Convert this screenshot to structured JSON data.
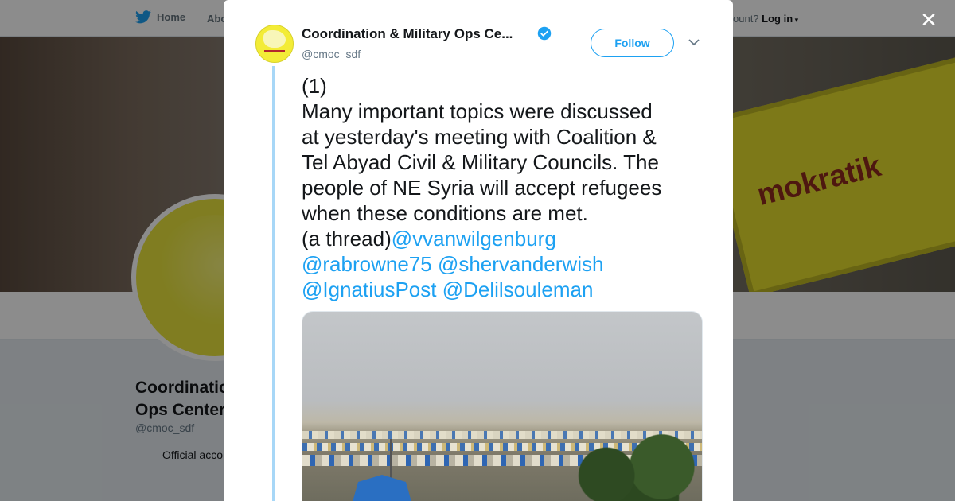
{
  "background": {
    "nav": {
      "home_label": "Home",
      "about_label": "Abo",
      "account_prompt": "ccount?",
      "login_label": "Log in"
    },
    "banner_patch_text": "mokratik",
    "profile": {
      "name": "Coordinatio Ops Center",
      "handle": "@cmoc_sdf",
      "bio_line": "Official acco"
    }
  },
  "modal": {
    "user": {
      "name": "Coordination & Military Ops Ce...",
      "handle": "@cmoc_sdf",
      "verified": true
    },
    "follow_label": "Follow",
    "tweet": {
      "lines": [
        "(1)",
        "Many important topics were discussed",
        "at yesterday's meeting with Coalition &",
        "Tel Abyad Civil & Military Councils. The",
        "people of NE Syria will accept refugees",
        "when these conditions are met.",
        "(a thread)"
      ],
      "mentions": [
        "@vvanwilgenburg",
        "@rabrowne75",
        "@shervanderwish",
        "@IgnatiusPost",
        "@Delilsouleman"
      ]
    }
  },
  "colors": {
    "link": "#1da1f2",
    "thread_line": "#a7d7f7",
    "avatar_yellow": "#f3ec37"
  }
}
